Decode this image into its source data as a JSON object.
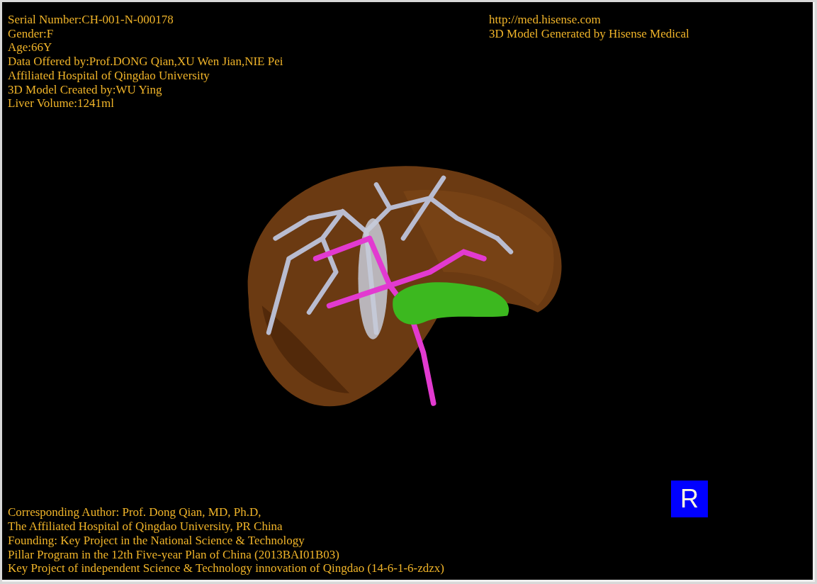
{
  "info_top_left": [
    "Serial Number:CH-001-N-000178",
    "Gender:F",
    "Age:66Y",
    "Data Offered by:Prof.DONG Qian,XU Wen Jian,NIE Pei",
    "Affiliated Hospital of Qingdao University",
    "3D Model Created by:WU Ying",
    "Liver Volume:1241ml"
  ],
  "info_top_right": [
    "http://med.hisense.com",
    "3D Model Generated by Hisense Medical"
  ],
  "orientation_marker": {
    "label": "R"
  },
  "info_bottom": [
    "Corresponding Author: Prof. Dong Qian, MD, Ph.D,",
    "The Affiliated Hospital of Qingdao University, PR China",
    "Founding: Key Project in the National Science & Technology",
    "Pillar Program in the 12th Five-year Plan of China (2013BAI01B03)",
    "Key Project of independent Science & Technology innovation of Qingdao (14-6-1-6-zdzx)"
  ]
}
